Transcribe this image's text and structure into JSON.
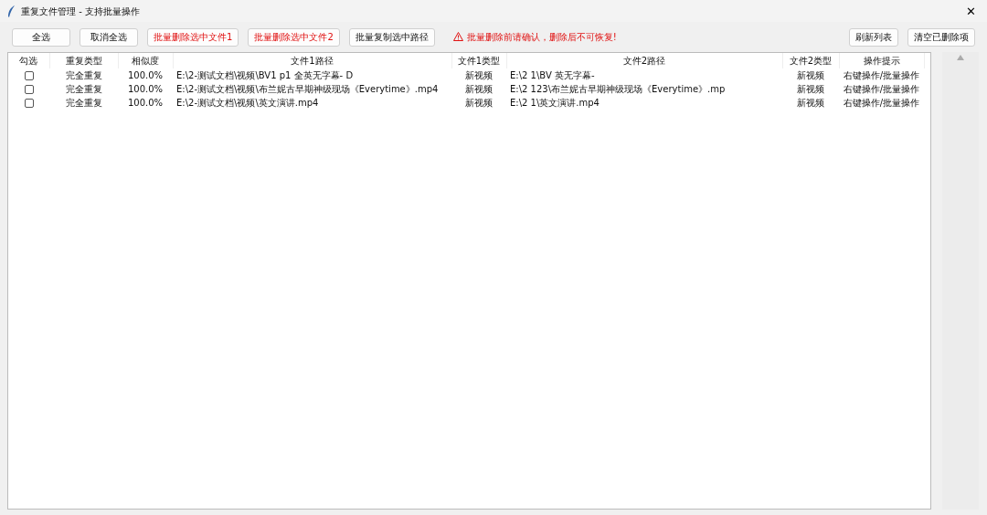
{
  "window": {
    "title": "重复文件管理 - 支持批量操作",
    "close": "✕"
  },
  "toolbar": {
    "buttons": [
      {
        "label": "全选",
        "kind": "normal"
      },
      {
        "label": "取消全选",
        "kind": "normal"
      },
      {
        "label": "批量删除选中文件1",
        "kind": "danger"
      },
      {
        "label": "批量删除选中文件2",
        "kind": "danger"
      },
      {
        "label": "批量复制选中路径",
        "kind": "normal"
      }
    ],
    "warning": "批量删除前请确认，删除后不可恢复!",
    "right_buttons": [
      "刷新列表",
      "清空已删除项"
    ]
  },
  "table": {
    "columns": [
      "勾选",
      "重复类型",
      "相似度",
      "文件1路径",
      "文件1类型",
      "文件2路径",
      "文件2类型",
      "操作提示"
    ],
    "rows": [
      {
        "cells": [
          {
            "kind": "checkbox",
            "checked": false
          },
          "完全重复",
          "100.0%",
          "E:\\2-测试文档\\视频\\BV1          p1      全英无字幕- D",
          "新视频",
          "E:\\2           1\\BV             英无字幕-",
          "新视频",
          "右键操作/批量操作"
        ]
      },
      {
        "cells": [
          {
            "kind": "checkbox",
            "checked": false
          },
          "完全重复",
          "100.0%",
          "E:\\2-测试文档\\视频\\布兰妮古早期神级现场《Everytime》.mp4",
          "新视频",
          "E:\\2           123\\布兰妮古早期神级现场《Everytime》.mp",
          "新视频",
          "右键操作/批量操作"
        ]
      },
      {
        "cells": [
          {
            "kind": "checkbox",
            "checked": false
          },
          "完全重复",
          "100.0%",
          "E:\\2-测试文档\\视频\\英文演讲.mp4",
          "新视频",
          "E:\\2           1\\英文演讲.mp4",
          "新视频",
          "右键操作/批量操作"
        ]
      }
    ]
  }
}
